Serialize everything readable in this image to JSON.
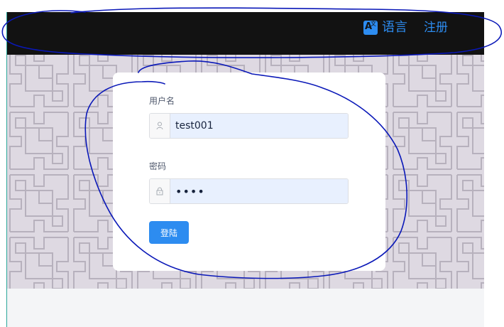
{
  "header": {
    "language_label": "语言",
    "language_icon": "translate-icon",
    "register_label": "注册"
  },
  "login_form": {
    "username_label": "用户名",
    "username_value": "test001",
    "username_icon": "user-icon",
    "password_label": "密码",
    "password_value": "••••",
    "password_icon": "lock-icon",
    "submit_label": "登陆"
  },
  "colors": {
    "topbar": "#121212",
    "accent": "#2d8cf0",
    "pattern_bg": "#ded9e2",
    "autofill_bg": "#e8f0fe",
    "annotation": "#0a18b8"
  }
}
